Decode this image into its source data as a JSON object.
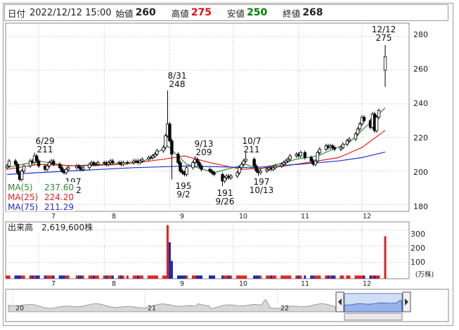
{
  "info": {
    "date_label": "日付",
    "datetime": "2022/12/12 15:00",
    "open_label": "始値",
    "open": "260",
    "high_label": "高値",
    "high": "275",
    "low_label": "安値",
    "low": "250",
    "close_label": "終値",
    "close": "268"
  },
  "price_panel": {
    "y_ticks": [
      "280",
      "260",
      "240",
      "220",
      "200",
      "180"
    ],
    "x_ticks": [
      "7",
      "8",
      "9",
      "10",
      "11",
      "12"
    ],
    "ma_legend": [
      {
        "label": "MA(5)",
        "value": "237.60",
        "color": "#2e8b2e"
      },
      {
        "label": "MA(25)",
        "value": "224.20",
        "color": "#e02020"
      },
      {
        "label": "MA(75)",
        "value": "211.29",
        "color": "#2030d0"
      }
    ],
    "annotations": [
      {
        "top": "6/29",
        "bottom": "211"
      },
      {
        "top": "8/31",
        "bottom": "248"
      },
      {
        "top": "9/13",
        "bottom": "209"
      },
      {
        "top": "10/7",
        "bottom": "211"
      },
      {
        "top": "12/12",
        "bottom": "275"
      },
      {
        "top": "195",
        "bottom": "9/2"
      },
      {
        "top": "191",
        "bottom": "9/26"
      },
      {
        "top": "197",
        "bottom": "10/13"
      },
      {
        "top": "197",
        "bottom": "2"
      }
    ]
  },
  "volume_panel": {
    "title": "出来高　2,619,600株",
    "y_ticks": [
      "300",
      "200",
      "100"
    ],
    "unit": "(万株)",
    "x_ticks": [
      "7",
      "8",
      "9",
      "10",
      "11",
      "12"
    ]
  },
  "navigator": {
    "year_labels": [
      "20",
      "21",
      "22"
    ]
  },
  "chart_data": {
    "type": "candlestick",
    "ylim": [
      176,
      288
    ],
    "y_ticks": [
      180,
      200,
      220,
      240,
      260,
      280
    ],
    "visible_start": "2022-06-16",
    "visible_end": "2022-12-12",
    "last_candle": {
      "date": "2022-12-12",
      "open": 260,
      "high": 275,
      "low": 250,
      "close": 268
    },
    "key_points": [
      {
        "date": "2022-06-29",
        "value": 211,
        "kind": "high"
      },
      {
        "date": "2022-08-31",
        "value": 248,
        "kind": "high"
      },
      {
        "date": "2022-09-02",
        "value": 195,
        "kind": "low"
      },
      {
        "date": "2022-09-13",
        "value": 209,
        "kind": "high"
      },
      {
        "date": "2022-09-26",
        "value": 191,
        "kind": "low"
      },
      {
        "date": "2022-10-07",
        "value": 211,
        "kind": "high"
      },
      {
        "date": "2022-10-13",
        "value": 197,
        "kind": "low"
      },
      {
        "date": "2022-12-12",
        "value": 275,
        "kind": "high"
      }
    ],
    "close_path": [
      [
        "2022-06-16",
        203
      ],
      [
        "2022-06-17",
        206
      ],
      [
        "2022-06-20",
        204
      ],
      [
        "2022-06-21",
        199
      ],
      [
        "2022-06-22",
        195
      ],
      [
        "2022-06-23",
        200
      ],
      [
        "2022-06-24",
        203
      ],
      [
        "2022-06-27",
        206
      ],
      [
        "2022-06-28",
        205
      ],
      [
        "2022-06-29",
        209
      ],
      [
        "2022-06-30",
        206
      ],
      [
        "2022-07-01",
        203
      ],
      [
        "2022-07-04",
        201
      ],
      [
        "2022-07-05",
        203
      ],
      [
        "2022-07-06",
        205
      ],
      [
        "2022-07-07",
        206
      ],
      [
        "2022-07-08",
        204
      ],
      [
        "2022-07-11",
        202
      ],
      [
        "2022-07-12",
        200
      ],
      [
        "2022-07-13",
        199
      ],
      [
        "2022-07-14",
        201
      ],
      [
        "2022-07-15",
        202
      ],
      [
        "2022-07-19",
        203
      ],
      [
        "2022-07-20",
        202
      ],
      [
        "2022-07-21",
        201
      ],
      [
        "2022-07-22",
        202
      ],
      [
        "2022-07-25",
        204
      ],
      [
        "2022-07-26",
        205
      ],
      [
        "2022-07-27",
        204
      ],
      [
        "2022-07-28",
        204
      ],
      [
        "2022-07-29",
        205
      ],
      [
        "2022-08-01",
        205
      ],
      [
        "2022-08-02",
        204
      ],
      [
        "2022-08-03",
        205
      ],
      [
        "2022-08-04",
        206
      ],
      [
        "2022-08-05",
        205
      ],
      [
        "2022-08-08",
        205
      ],
      [
        "2022-08-09",
        204
      ],
      [
        "2022-08-10",
        205
      ],
      [
        "2022-08-12",
        205
      ],
      [
        "2022-08-15",
        206
      ],
      [
        "2022-08-16",
        206
      ],
      [
        "2022-08-17",
        205
      ],
      [
        "2022-08-18",
        206
      ],
      [
        "2022-08-19",
        207
      ],
      [
        "2022-08-22",
        208
      ],
      [
        "2022-08-23",
        208
      ],
      [
        "2022-08-24",
        209
      ],
      [
        "2022-08-25",
        210
      ],
      [
        "2022-08-26",
        212
      ],
      [
        "2022-08-29",
        214
      ],
      [
        "2022-08-30",
        221
      ],
      [
        "2022-08-31",
        228
      ],
      [
        "2022-09-01",
        218
      ],
      [
        "2022-09-02",
        210
      ],
      [
        "2022-09-05",
        205
      ],
      [
        "2022-09-06",
        200
      ],
      [
        "2022-09-07",
        199
      ],
      [
        "2022-09-08",
        198
      ],
      [
        "2022-09-09",
        202
      ],
      [
        "2022-09-12",
        205
      ],
      [
        "2022-09-13",
        207
      ],
      [
        "2022-09-14",
        205
      ],
      [
        "2022-09-15",
        203
      ],
      [
        "2022-09-16",
        201
      ],
      [
        "2022-09-20",
        200
      ],
      [
        "2022-09-21",
        199
      ],
      [
        "2022-09-22",
        198
      ],
      [
        "2022-09-26",
        194
      ],
      [
        "2022-09-27",
        196
      ],
      [
        "2022-09-28",
        197
      ],
      [
        "2022-09-29",
        196
      ],
      [
        "2022-09-30",
        197
      ],
      [
        "2022-10-03",
        199
      ],
      [
        "2022-10-04",
        202
      ],
      [
        "2022-10-05",
        204
      ],
      [
        "2022-10-06",
        206
      ],
      [
        "2022-10-07",
        207
      ],
      [
        "2022-10-11",
        203
      ],
      [
        "2022-10-12",
        200
      ],
      [
        "2022-10-13",
        199
      ],
      [
        "2022-10-14",
        200
      ],
      [
        "2022-10-17",
        201
      ],
      [
        "2022-10-18",
        202
      ],
      [
        "2022-10-19",
        201
      ],
      [
        "2022-10-20",
        202
      ],
      [
        "2022-10-21",
        203
      ],
      [
        "2022-10-24",
        204
      ],
      [
        "2022-10-25",
        205
      ],
      [
        "2022-10-26",
        206
      ],
      [
        "2022-10-27",
        207
      ],
      [
        "2022-10-28",
        209
      ],
      [
        "2022-10-31",
        210
      ],
      [
        "2022-11-01",
        209
      ],
      [
        "2022-11-02",
        211
      ],
      [
        "2022-11-04",
        208
      ],
      [
        "2022-11-07",
        206
      ],
      [
        "2022-11-08",
        204
      ],
      [
        "2022-11-09",
        206
      ],
      [
        "2022-11-10",
        211
      ],
      [
        "2022-11-11",
        213
      ],
      [
        "2022-11-14",
        215
      ],
      [
        "2022-11-15",
        214
      ],
      [
        "2022-11-16",
        215
      ],
      [
        "2022-11-17",
        214
      ],
      [
        "2022-11-18",
        213
      ],
      [
        "2022-11-21",
        214
      ],
      [
        "2022-11-22",
        216
      ],
      [
        "2022-11-24",
        218
      ],
      [
        "2022-11-25",
        219
      ],
      [
        "2022-11-28",
        222
      ],
      [
        "2022-11-29",
        225
      ],
      [
        "2022-11-30",
        228
      ],
      [
        "2022-12-01",
        232
      ],
      [
        "2022-12-02",
        230
      ],
      [
        "2022-12-05",
        226
      ],
      [
        "2022-12-06",
        234
      ],
      [
        "2022-12-07",
        224
      ],
      [
        "2022-12-08",
        232
      ],
      [
        "2022-12-09",
        236
      ],
      [
        "2022-12-12",
        268
      ]
    ],
    "ma_series": [
      {
        "name": "MA(5)",
        "latest": 237.6,
        "color": "#2e8b2e",
        "path": [
          [
            "2022-06-16",
            202
          ],
          [
            "2022-07-01",
            206
          ],
          [
            "2022-07-15",
            203
          ],
          [
            "2022-08-01",
            204
          ],
          [
            "2022-08-20",
            206
          ],
          [
            "2022-08-31",
            215
          ],
          [
            "2022-09-09",
            204
          ],
          [
            "2022-09-22",
            199
          ],
          [
            "2022-10-07",
            204
          ],
          [
            "2022-10-13",
            201
          ],
          [
            "2022-10-31",
            207
          ],
          [
            "2022-11-10",
            209
          ],
          [
            "2022-11-25",
            217
          ],
          [
            "2022-12-05",
            229
          ],
          [
            "2022-12-12",
            237.6
          ]
        ]
      },
      {
        "name": "MA(25)",
        "latest": 224.2,
        "color": "#e02020",
        "path": [
          [
            "2022-06-16",
            201
          ],
          [
            "2022-07-01",
            204
          ],
          [
            "2022-07-20",
            203
          ],
          [
            "2022-08-10",
            204
          ],
          [
            "2022-08-29",
            207
          ],
          [
            "2022-09-08",
            209
          ],
          [
            "2022-09-20",
            205
          ],
          [
            "2022-10-05",
            201
          ],
          [
            "2022-10-20",
            202
          ],
          [
            "2022-11-05",
            205
          ],
          [
            "2022-11-20",
            208
          ],
          [
            "2022-12-01",
            214
          ],
          [
            "2022-12-12",
            224.2
          ]
        ]
      },
      {
        "name": "MA(75)",
        "latest": 211.29,
        "color": "#2030d0",
        "path": [
          [
            "2022-06-16",
            198
          ],
          [
            "2022-07-15",
            200
          ],
          [
            "2022-08-15",
            202
          ],
          [
            "2022-09-10",
            203
          ],
          [
            "2022-10-10",
            202
          ],
          [
            "2022-11-01",
            204
          ],
          [
            "2022-11-20",
            206
          ],
          [
            "2022-12-01",
            208
          ],
          [
            "2022-12-12",
            211.29
          ]
        ]
      }
    ],
    "volume": {
      "unit": "万株",
      "ylim": [
        0,
        350
      ],
      "y_ticks": [
        100,
        200,
        300
      ],
      "latest": 261.96,
      "spikes": [
        {
          "date": "2022-08-31",
          "value": 330
        },
        {
          "date": "2022-09-01",
          "value": 225
        },
        {
          "date": "2022-09-02",
          "value": 110
        },
        {
          "date": "2022-12-12",
          "value": 261.96
        }
      ],
      "baseline_value": 20
    },
    "navigator": {
      "year_labels": [
        "20",
        "21",
        "22"
      ]
    }
  }
}
